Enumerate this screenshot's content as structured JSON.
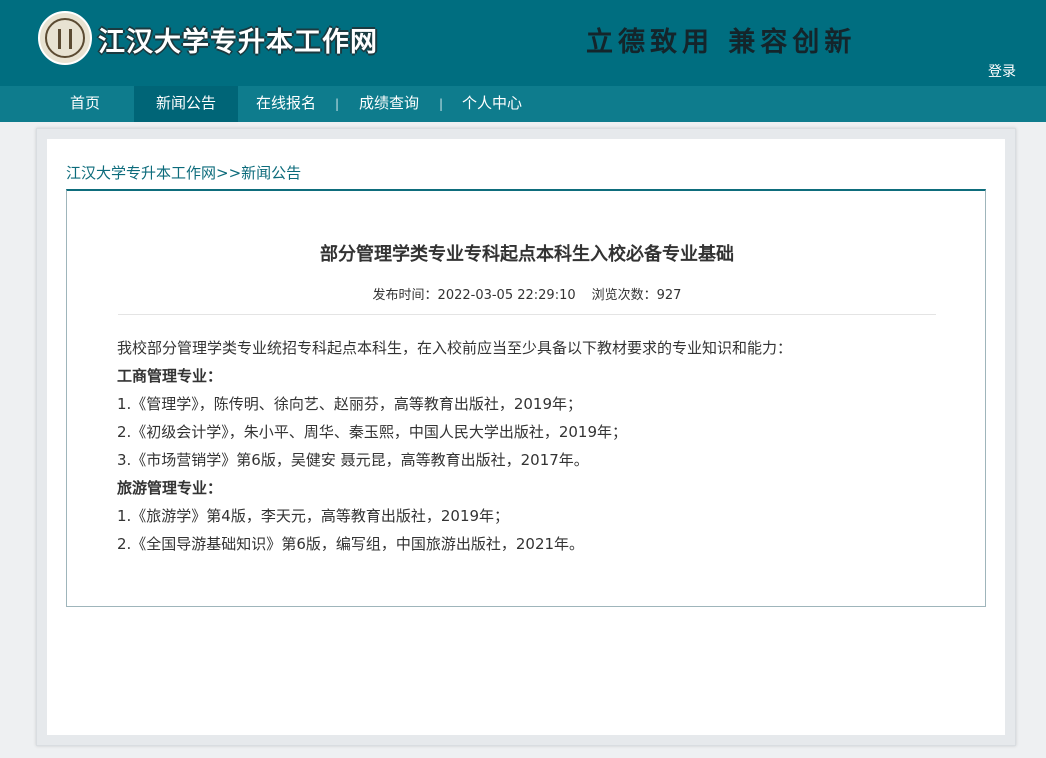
{
  "header": {
    "site_title": "江汉大学专升本工作网",
    "motto": "立德致用 兼容创新",
    "login_label": "登录",
    "logo_icon": "university-seal-icon"
  },
  "nav": {
    "items": [
      {
        "label": "首页"
      },
      {
        "label": "新闻公告",
        "active": true
      },
      {
        "label": "在线报名"
      },
      {
        "label": "成绩查询"
      },
      {
        "label": "个人中心"
      }
    ],
    "separator": "|"
  },
  "breadcrumb": {
    "home": "江汉大学专升本工作网",
    "sep": ">>",
    "current": "新闻公告"
  },
  "article": {
    "title": "部分管理学类专业专科起点本科生入校必备专业基础",
    "publish_label": "发布时间：",
    "publish_time": "2022-03-05 22:29:10",
    "views_label": "浏览次数：",
    "views": "927",
    "lines": [
      {
        "text": "我校部分管理学类专业统招专科起点本科生，在入校前应当至少具备以下教材要求的专业知识和能力：",
        "bold": false
      },
      {
        "text": "工商管理专业：",
        "bold": true
      },
      {
        "text": "1.《管理学》，陈传明、徐向艺、赵丽芬，高等教育出版社，2019年；",
        "bold": false
      },
      {
        "text": "2.《初级会计学》，朱小平、周华、秦玉熙，中国人民大学出版社，2019年；",
        "bold": false
      },
      {
        "text": "3.《市场营销学》第6版，吴健安 聂元昆，高等教育出版社，2017年。",
        "bold": false
      },
      {
        "text": "旅游管理专业：",
        "bold": true
      },
      {
        "text": "1.《旅游学》第4版，李天元，高等教育出版社，2019年；",
        "bold": false
      },
      {
        "text": "2.《全国导游基础知识》第6版，编写组，中国旅游出版社，2021年。",
        "bold": false
      }
    ]
  },
  "colors": {
    "header_bg": "#006e80",
    "nav_bg": "#0e7c8d",
    "nav_active_bg": "#006577",
    "link": "#0c6b7b"
  }
}
